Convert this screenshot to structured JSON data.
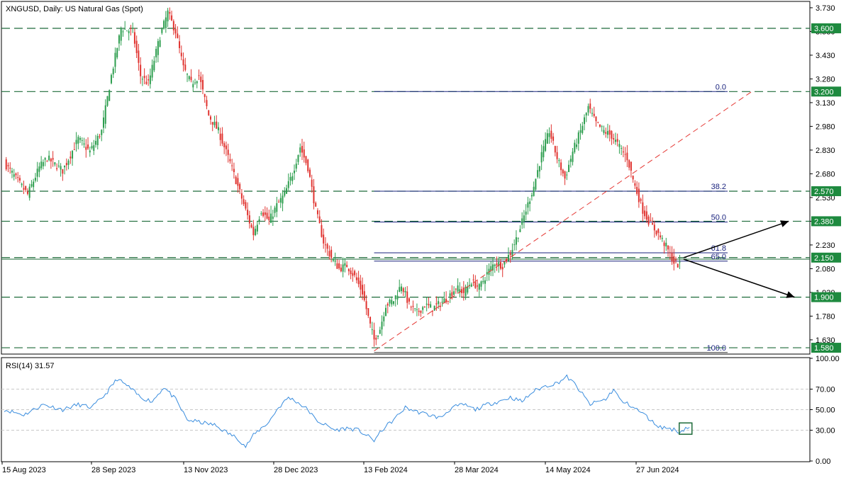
{
  "header": {
    "symbol_info": "XNGUSD, Daily:  US Natural Gas (Spot)",
    "rsi_label": "RSI(14) 31.57"
  },
  "colors": {
    "bull": "#2e9e4f",
    "bear": "#e0332f",
    "hline": "#1e6b3a",
    "label_bg": "#1e8a3f",
    "fib": "#1a237e",
    "trend": "#e53935",
    "rsi": "#3a8dde",
    "arrow": "#000000"
  },
  "chart_data": {
    "type": "candlestick",
    "x_tick_labels": [
      "15 Aug 2023",
      "28 Sep 2023",
      "13 Nov 2023",
      "28 Dec 2023",
      "13 Feb 2024",
      "28 Mar 2024",
      "14 May 2024",
      "27 Jun 2024"
    ],
    "y_tick_labels": [
      "3.730",
      "3.580",
      "3.430",
      "3.280",
      "3.130",
      "2.980",
      "2.830",
      "2.680",
      "2.530",
      "2.380",
      "2.230",
      "2.080",
      "1.930",
      "1.780",
      "1.630"
    ],
    "ylim": [
      1.54,
      3.77
    ],
    "anchors": [
      [
        0,
        2.75
      ],
      [
        6,
        2.65
      ],
      [
        12,
        2.55
      ],
      [
        18,
        2.72
      ],
      [
        22,
        2.78
      ],
      [
        30,
        2.7
      ],
      [
        38,
        2.9
      ],
      [
        44,
        2.82
      ],
      [
        50,
        2.95
      ],
      [
        55,
        3.3
      ],
      [
        60,
        3.6
      ],
      [
        66,
        3.58
      ],
      [
        70,
        3.3
      ],
      [
        74,
        3.25
      ],
      [
        80,
        3.55
      ],
      [
        84,
        3.7
      ],
      [
        88,
        3.58
      ],
      [
        92,
        3.35
      ],
      [
        96,
        3.25
      ],
      [
        100,
        3.3
      ],
      [
        105,
        3.05
      ],
      [
        110,
        2.95
      ],
      [
        116,
        2.75
      ],
      [
        120,
        2.6
      ],
      [
        124,
        2.45
      ],
      [
        128,
        2.3
      ],
      [
        132,
        2.45
      ],
      [
        136,
        2.38
      ],
      [
        140,
        2.48
      ],
      [
        144,
        2.55
      ],
      [
        148,
        2.68
      ],
      [
        152,
        2.85
      ],
      [
        156,
        2.72
      ],
      [
        160,
        2.45
      ],
      [
        164,
        2.25
      ],
      [
        168,
        2.15
      ],
      [
        172,
        2.08
      ],
      [
        176,
        2.1
      ],
      [
        180,
        2.03
      ],
      [
        184,
        1.93
      ],
      [
        188,
        1.72
      ],
      [
        190,
        1.63
      ],
      [
        193,
        1.7
      ],
      [
        196,
        1.85
      ],
      [
        200,
        1.88
      ],
      [
        204,
        1.98
      ],
      [
        208,
        1.85
      ],
      [
        212,
        1.8
      ],
      [
        216,
        1.85
      ],
      [
        220,
        1.83
      ],
      [
        224,
        1.86
      ],
      [
        228,
        1.9
      ],
      [
        232,
        1.96
      ],
      [
        236,
        1.93
      ],
      [
        240,
        2.0
      ],
      [
        244,
        1.96
      ],
      [
        248,
        2.05
      ],
      [
        252,
        2.12
      ],
      [
        256,
        2.1
      ],
      [
        260,
        2.18
      ],
      [
        264,
        2.3
      ],
      [
        268,
        2.45
      ],
      [
        272,
        2.6
      ],
      [
        276,
        2.8
      ],
      [
        280,
        2.95
      ],
      [
        284,
        2.78
      ],
      [
        288,
        2.65
      ],
      [
        292,
        2.82
      ],
      [
        296,
        2.95
      ],
      [
        300,
        3.1
      ],
      [
        304,
        3.0
      ],
      [
        308,
        2.95
      ],
      [
        312,
        2.92
      ],
      [
        316,
        2.85
      ],
      [
        320,
        2.78
      ],
      [
        324,
        2.6
      ],
      [
        328,
        2.45
      ],
      [
        332,
        2.36
      ],
      [
        336,
        2.3
      ],
      [
        340,
        2.22
      ],
      [
        344,
        2.12
      ],
      [
        347,
        2.1
      ]
    ],
    "horizontal_levels": [
      3.6,
      3.2,
      2.57,
      2.38,
      2.15,
      1.9,
      1.58
    ],
    "level_labels": [
      "3.600",
      "3.200",
      "2.570",
      "2.380",
      "2.150",
      "1.900",
      "1.580"
    ],
    "current_price": 2.14,
    "fibonacci": {
      "high": 3.2,
      "low": 1.55,
      "levels": [
        0,
        38.2,
        50.0,
        61.8,
        65.0,
        100.0
      ],
      "labels": [
        "0.0",
        "38.2",
        "50.0",
        "61.8",
        "65.0",
        "100.0"
      ]
    },
    "trendline": {
      "from": [
        190,
        1.56
      ],
      "to": [
        384,
        3.2
      ]
    },
    "arrows": [
      {
        "from": [
          349,
          2.15
        ],
        "to": [
          403,
          2.38
        ]
      },
      {
        "from": [
          349,
          2.14
        ],
        "to": [
          406,
          1.9
        ]
      }
    ],
    "rsi": {
      "name": "RSI(14)",
      "last": 31.57,
      "ylim": [
        0,
        100
      ],
      "y_tick_labels": [
        "100.00",
        "70.00",
        "50.00",
        "30.00",
        "0.00"
      ],
      "levels": [
        70,
        50,
        30
      ],
      "anchors": [
        [
          0,
          50
        ],
        [
          10,
          45
        ],
        [
          20,
          55
        ],
        [
          30,
          50
        ],
        [
          38,
          55
        ],
        [
          45,
          52
        ],
        [
          52,
          65
        ],
        [
          58,
          80
        ],
        [
          64,
          72
        ],
        [
          70,
          62
        ],
        [
          76,
          58
        ],
        [
          82,
          72
        ],
        [
          88,
          60
        ],
        [
          94,
          40
        ],
        [
          100,
          38
        ],
        [
          108,
          35
        ],
        [
          115,
          27
        ],
        [
          120,
          22
        ],
        [
          124,
          14
        ],
        [
          128,
          25
        ],
        [
          132,
          32
        ],
        [
          136,
          38
        ],
        [
          140,
          50
        ],
        [
          146,
          62
        ],
        [
          150,
          58
        ],
        [
          156,
          50
        ],
        [
          160,
          40
        ],
        [
          165,
          35
        ],
        [
          170,
          30
        ],
        [
          176,
          32
        ],
        [
          182,
          30
        ],
        [
          186,
          25
        ],
        [
          190,
          20
        ],
        [
          195,
          32
        ],
        [
          200,
          40
        ],
        [
          206,
          52
        ],
        [
          212,
          48
        ],
        [
          218,
          45
        ],
        [
          224,
          42
        ],
        [
          230,
          52
        ],
        [
          236,
          55
        ],
        [
          242,
          50
        ],
        [
          248,
          55
        ],
        [
          254,
          58
        ],
        [
          260,
          62
        ],
        [
          266,
          58
        ],
        [
          272,
          68
        ],
        [
          278,
          73
        ],
        [
          284,
          76
        ],
        [
          289,
          82
        ],
        [
          293,
          75
        ],
        [
          297,
          65
        ],
        [
          301,
          55
        ],
        [
          305,
          58
        ],
        [
          309,
          60
        ],
        [
          313,
          70
        ],
        [
          317,
          58
        ],
        [
          321,
          55
        ],
        [
          325,
          50
        ],
        [
          329,
          45
        ],
        [
          333,
          38
        ],
        [
          337,
          33
        ],
        [
          341,
          32
        ],
        [
          345,
          30
        ],
        [
          347,
          28
        ],
        [
          350,
          32
        ],
        [
          352,
          33
        ]
      ]
    }
  }
}
